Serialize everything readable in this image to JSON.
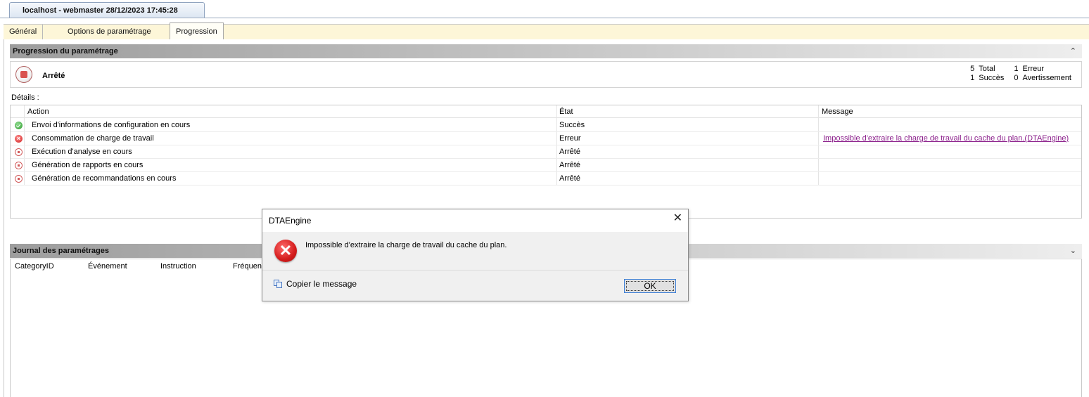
{
  "document_tab": {
    "title": "localhost - webmaster 28/12/2023 17:45:28"
  },
  "tabs": [
    {
      "label": "Général"
    },
    {
      "label": "Options de paramétrage"
    },
    {
      "label": "Progression"
    }
  ],
  "progress_section": {
    "title": "Progression du paramétrage",
    "collapse_icon": "chevron-double-up",
    "status": "Arrêté",
    "stats": {
      "total_value": "5",
      "total_label": "Total",
      "success_value": "1",
      "success_label": "Succès",
      "error_value": "1",
      "error_label": "Erreur",
      "warning_value": "0",
      "warning_label": "Avertissement"
    }
  },
  "details": {
    "label": "Détails :",
    "columns": {
      "action": "Action",
      "state": "État",
      "message": "Message"
    },
    "rows": [
      {
        "icon": "success-icon",
        "action": "Envoi d'informations de configuration en cours",
        "state": "Succès",
        "message": ""
      },
      {
        "icon": "error-icon",
        "action": "Consommation de charge de travail",
        "state": "Erreur",
        "message": "Impossible d'extraire la charge de travail du cache du plan.(DTAEngine)"
      },
      {
        "icon": "stop-icon",
        "action": "Exécution d'analyse en cours",
        "state": "Arrêté",
        "message": ""
      },
      {
        "icon": "stop-icon",
        "action": "Génération de rapports en cours",
        "state": "Arrêté",
        "message": ""
      },
      {
        "icon": "stop-icon",
        "action": "Génération de recommandations en cours",
        "state": "Arrêté",
        "message": ""
      }
    ]
  },
  "journal": {
    "title": "Journal des paramétrages",
    "expand_icon": "chevron-double-down",
    "columns": [
      "CategoryID",
      "Événement",
      "Instruction",
      "Fréquence"
    ]
  },
  "dialog": {
    "title": "DTAEngine",
    "close_glyph": "✕",
    "message": "Impossible d'extraire la charge de travail du cache du plan.",
    "copy_label": "Copier le message",
    "ok_label": "OK"
  }
}
